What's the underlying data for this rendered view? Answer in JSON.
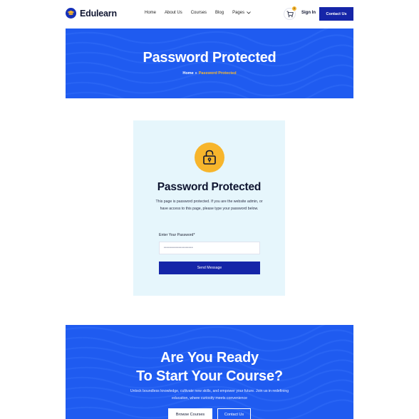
{
  "brand": {
    "name": "Edulearn",
    "color": "#1530b8",
    "accent": "#f7b52c"
  },
  "nav": {
    "items": [
      {
        "label": "Home"
      },
      {
        "label": "About Us"
      },
      {
        "label": "Courses"
      },
      {
        "label": "Blog"
      },
      {
        "label": "Pages"
      }
    ],
    "cart_icon": "cart-icon",
    "cart_badge": "0",
    "signin_label": "Sign In",
    "contact_label": "Contact Us"
  },
  "hero": {
    "title": "Password Protected",
    "breadcrumb": {
      "home": "Home",
      "separator": "»",
      "current": "Password Protected"
    },
    "background": "#1f5bf0"
  },
  "card": {
    "icon": "lock-open-icon",
    "title": "Password Protected",
    "description": "This page is password protected. If you are the website admin, or have access to this page, please type your password below.",
    "password_label": "Enter Your Password*",
    "password_value": "••••••••••••••••••••",
    "submit_label": "Send Message"
  },
  "cta": {
    "title_line1": "Are You Ready",
    "title_line2": "To Start Your Course?",
    "description": "Unlock boundless knowledge, cultivate new skills, and empower your future. Join us in redefining education, where curiosity meets convenience",
    "primary_label": "Browse Courses",
    "secondary_label": "Contact Us"
  }
}
